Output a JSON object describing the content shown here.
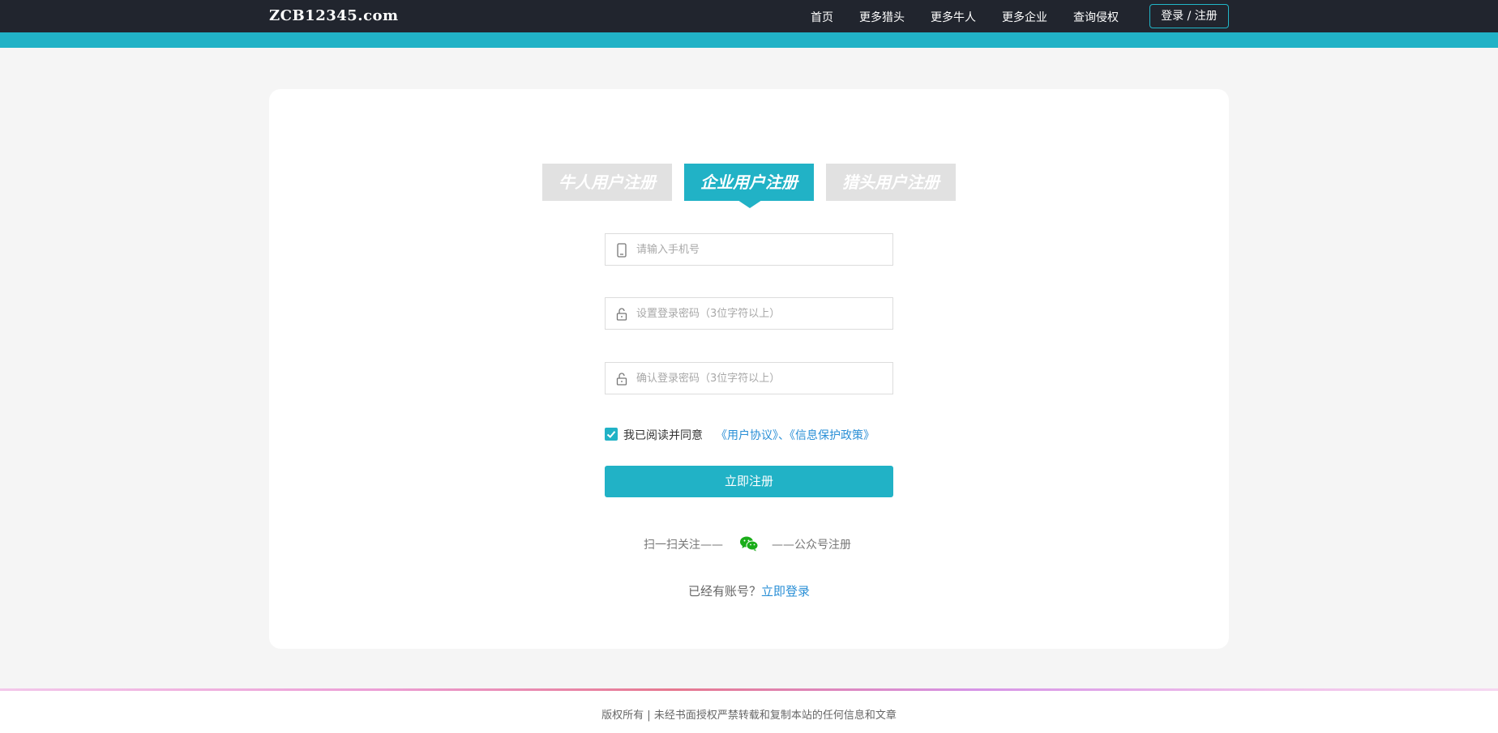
{
  "header": {
    "logo": "ZCB12345.com",
    "nav": [
      "首页",
      "更多猎头",
      "更多牛人",
      "更多企业",
      "查询侵权"
    ],
    "login_label": "登录 / 注册"
  },
  "tabs": [
    {
      "label": "牛人用户注册",
      "active": false
    },
    {
      "label": "企业用户注册",
      "active": true
    },
    {
      "label": "猎头用户注册",
      "active": false
    }
  ],
  "form": {
    "phone_placeholder": "请输入手机号",
    "password_placeholder": "设置登录密码（3位字符以上）",
    "confirm_placeholder": "确认登录密码（3位字符以上）",
    "agree_checked": true,
    "agree_text": "我已阅读并同意",
    "agree_links": "《用户协议》、《信息保护政策》",
    "submit_label": "立即注册"
  },
  "wechat": {
    "left_text": "扫一扫关注——",
    "right_text": "——公众号注册",
    "icon": "wechat-icon"
  },
  "login_prompt": {
    "question": "已经有账号？",
    "link": "立即登录"
  },
  "footer": {
    "text": "版权所有  |  未经书面授权严禁转载和复制本站的任何信息和文章"
  },
  "colors": {
    "header_bg": "#21252e",
    "accent": "#21b2c6",
    "link": "#2a8fd6",
    "tab_inactive": "#e1e1e1",
    "wechat": "#1aad19"
  }
}
